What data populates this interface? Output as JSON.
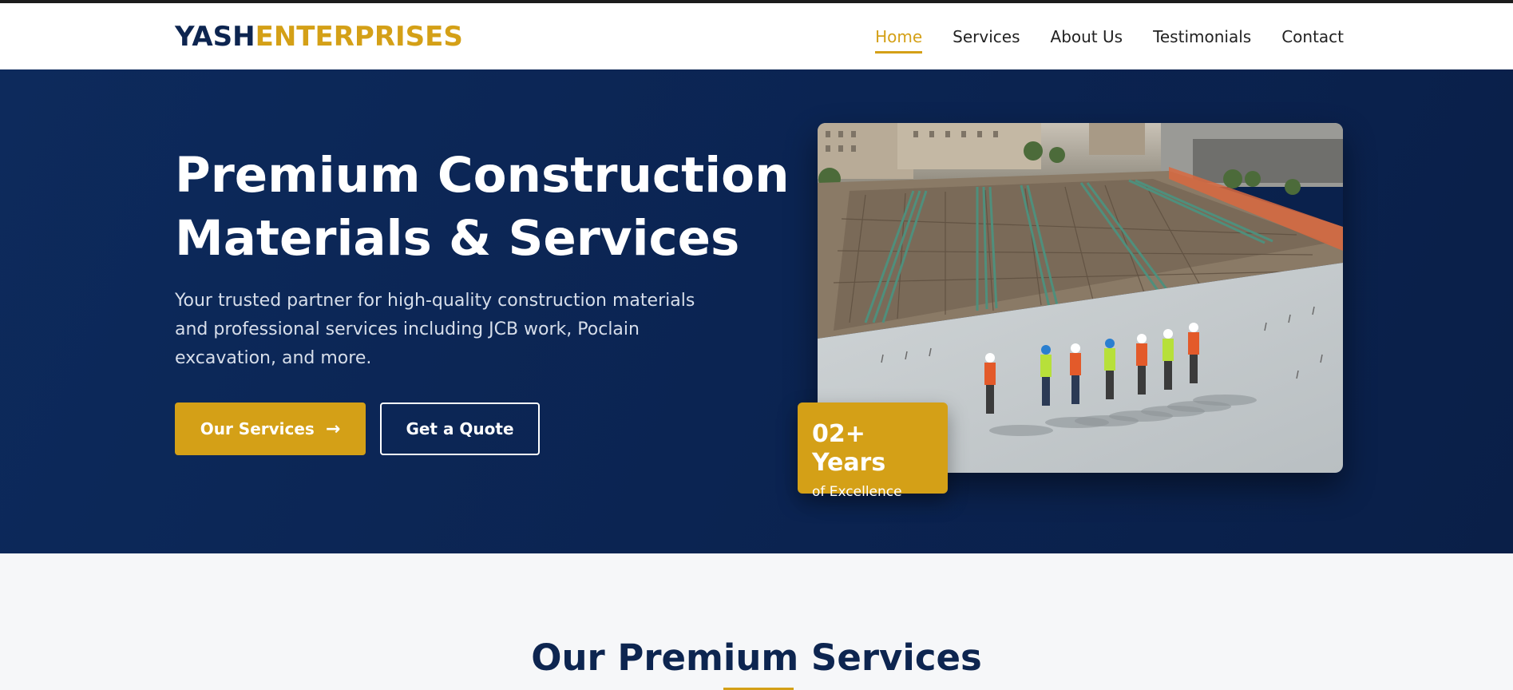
{
  "brand": {
    "part1": "YASH",
    "part2": "ENTERPRISES"
  },
  "nav": {
    "items": [
      {
        "label": "Home",
        "active": true
      },
      {
        "label": "Services"
      },
      {
        "label": "About Us"
      },
      {
        "label": "Testimonials"
      },
      {
        "label": "Contact"
      }
    ]
  },
  "hero": {
    "title_line1": "Premium Construction",
    "title_line2": "Materials & Services",
    "description": "Your trusted partner for high-quality construction materials and professional services including JCB work, Poclain excavation, and more.",
    "primary_button": "Our Services",
    "secondary_button": "Get a Quote",
    "badge_title": "02+ Years",
    "badge_subtitle": "of Excellence"
  },
  "section": {
    "title": "Our Premium Services"
  },
  "colors": {
    "navy": "#0d2550",
    "gold": "#d4a017",
    "hero_bg": "#0b2452"
  },
  "icons": {
    "button_arrow": "arrow-right-icon"
  }
}
